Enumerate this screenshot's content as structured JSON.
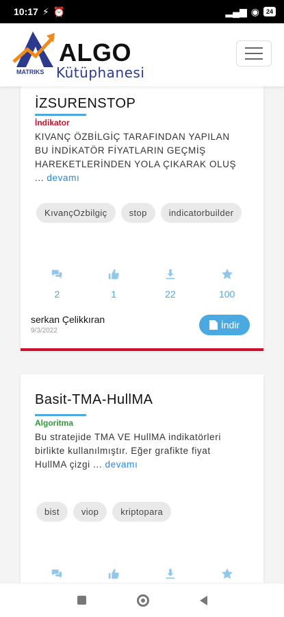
{
  "status_bar": {
    "time": "10:17",
    "battery": "24"
  },
  "header": {
    "logo_algo": "ALGO",
    "logo_kutuphanesi": "Kütüphanesi",
    "logo_matriks": "MATRIKS"
  },
  "cards": [
    {
      "title": "İZSURENSTOP",
      "category": "İndikator",
      "category_color": "#c8102e",
      "description": "KIVANÇ ÖZBİLGİÇ TARAFINDAN YAPILAN BU İNDİKATÖR FİYATLARIN GEÇMİŞ HAREKETLERİNDEN YOLA ÇIKARAK OLUŞ ...",
      "more": "devamı",
      "tags": [
        "KıvançOzbilgiç",
        "stop",
        "indicatorbuilder"
      ],
      "stats": {
        "comments": "2",
        "likes": "1",
        "downloads": "22",
        "favorites": "100"
      },
      "author": "serkan Çelikkıran",
      "date": "9/3/2022",
      "download_label": "İndir"
    },
    {
      "title": "Basit-TMA-HullMA",
      "category": "Algoritma",
      "category_color": "#2e9a3a",
      "description": "Bu stratejide TMA VE HullMA indikatörleri birlikte kullanılmıştır. Eğer grafikte fiyat HullMA çizgi ...",
      "more": "devamı",
      "tags": [
        "bist",
        "viop",
        "kriptopara"
      ]
    }
  ]
}
